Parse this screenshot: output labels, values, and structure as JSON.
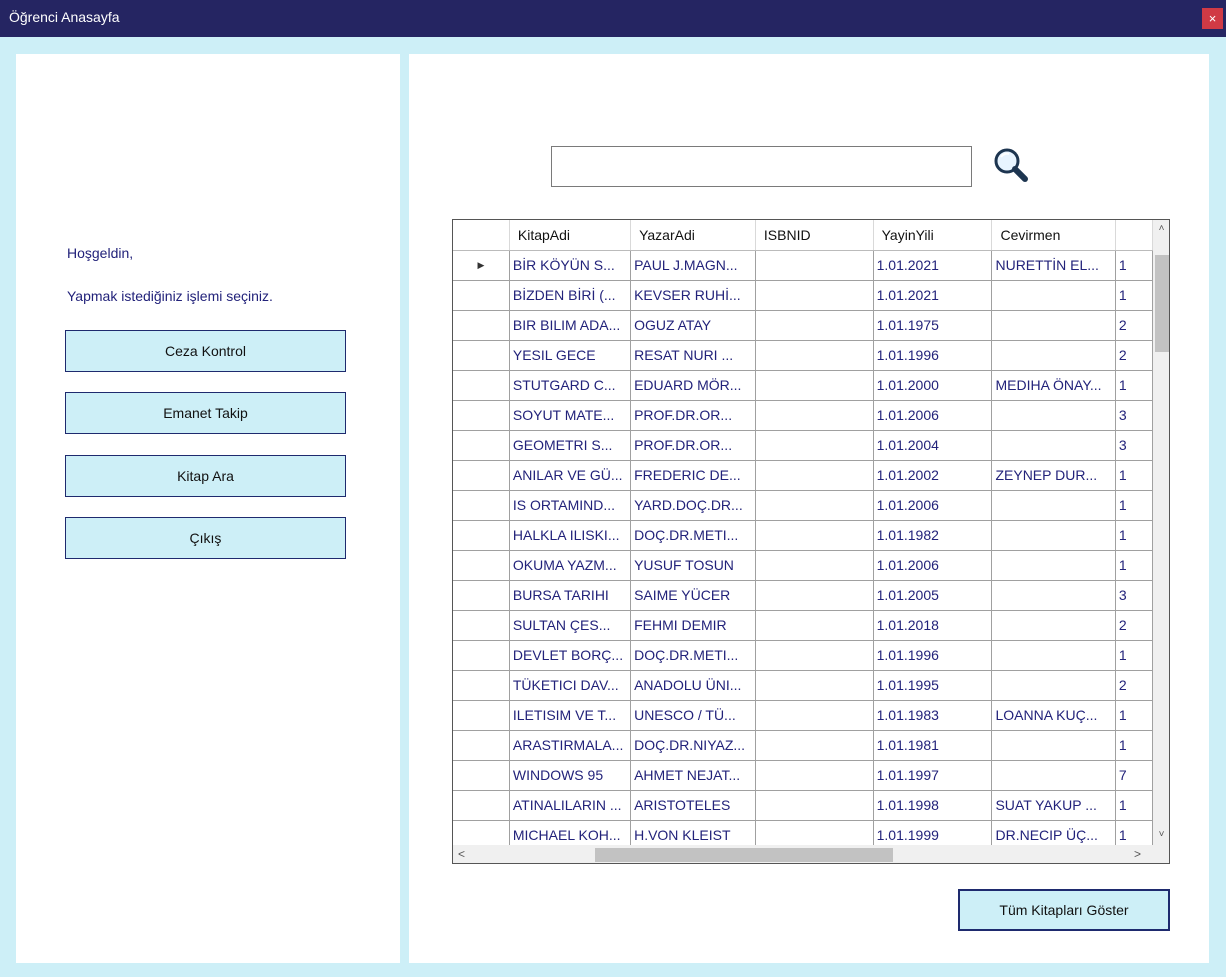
{
  "window": {
    "title": "Öğrenci Anasayfa",
    "close_label": "×"
  },
  "left": {
    "greeting": "Hoşgeldin,",
    "instruction": "Yapmak istediğiniz işlemi seçiniz.",
    "buttons": {
      "ceza": "Ceza Kontrol",
      "emanet": "Emanet Takip",
      "kitap_ara": "Kitap Ara",
      "cikis": "Çıkış"
    }
  },
  "search": {
    "value": "",
    "placeholder": ""
  },
  "grid": {
    "columns": [
      "KitapAdi",
      "YazarAdi",
      "ISBNID",
      "YayinYili",
      "Cevirmen",
      ""
    ],
    "rows": [
      [
        "BİR KÖYÜN S...",
        "PAUL J.MAGN...",
        "",
        "1.01.2021",
        "NURETTİN EL...",
        "1"
      ],
      [
        "BİZDEN BİRİ (...",
        "KEVSER RUHİ...",
        "",
        "1.01.2021",
        "",
        "1"
      ],
      [
        "BIR BILIM ADA...",
        "OGUZ ATAY",
        "",
        "1.01.1975",
        "",
        "2"
      ],
      [
        "YESIL GECE",
        "RESAT NURI ...",
        "",
        "1.01.1996",
        "",
        "2"
      ],
      [
        "STUTGARD C...",
        "EDUARD MÖR...",
        "",
        "1.01.2000",
        "MEDIHA ÖNAY...",
        "1"
      ],
      [
        "SOYUT MATE...",
        "PROF.DR.OR...",
        "",
        "1.01.2006",
        "",
        "3"
      ],
      [
        "GEOMETRI S...",
        "PROF.DR.OR...",
        "",
        "1.01.2004",
        "",
        "3"
      ],
      [
        "ANILAR VE GÜ...",
        "FREDERIC DE...",
        "",
        "1.01.2002",
        "ZEYNEP DUR...",
        "1"
      ],
      [
        "IS ORTAMIND...",
        "YARD.DOÇ.DR...",
        "",
        "1.01.2006",
        "",
        "1"
      ],
      [
        "HALKLA ILISKI...",
        "DOÇ.DR.METI...",
        "",
        "1.01.1982",
        "",
        "1"
      ],
      [
        "OKUMA YAZM...",
        "YUSUF TOSUN",
        "",
        "1.01.2006",
        "",
        "1"
      ],
      [
        "BURSA TARIHI",
        "SAIME YÜCER",
        "",
        "1.01.2005",
        "",
        "3"
      ],
      [
        "SULTAN ÇES...",
        "FEHMI DEMIR",
        "",
        "1.01.2018",
        "",
        "2"
      ],
      [
        "DEVLET BORÇ...",
        "DOÇ.DR.METI...",
        "",
        "1.01.1996",
        "",
        "1"
      ],
      [
        "TÜKETICI DAV...",
        "ANADOLU ÜNI...",
        "",
        "1.01.1995",
        "",
        "2"
      ],
      [
        "ILETISIM VE T...",
        "UNESCO / TÜ...",
        "",
        "1.01.1983",
        "LOANNA KUÇ...",
        "1"
      ],
      [
        "ARASTIRMALA...",
        "DOÇ.DR.NIYAZ...",
        "",
        "1.01.1981",
        "",
        "1"
      ],
      [
        "WINDOWS 95",
        "AHMET NEJAT...",
        "",
        "1.01.1997",
        "",
        "7"
      ],
      [
        "ATINALILARIN ...",
        "ARISTOTELES",
        "",
        "1.01.1998",
        "SUAT YAKUP ...",
        "1"
      ],
      [
        "MICHAEL KOH...",
        "H.VON KLEIST",
        "",
        "1.01.1999",
        "DR.NECIP ÜÇ...",
        "1"
      ]
    ],
    "current_row_indicator": "▶",
    "scroll": {
      "up": "˄",
      "down": "˅",
      "left": "<",
      "right": ">"
    }
  },
  "show_all_label": "Tüm Kitapları Göster"
}
